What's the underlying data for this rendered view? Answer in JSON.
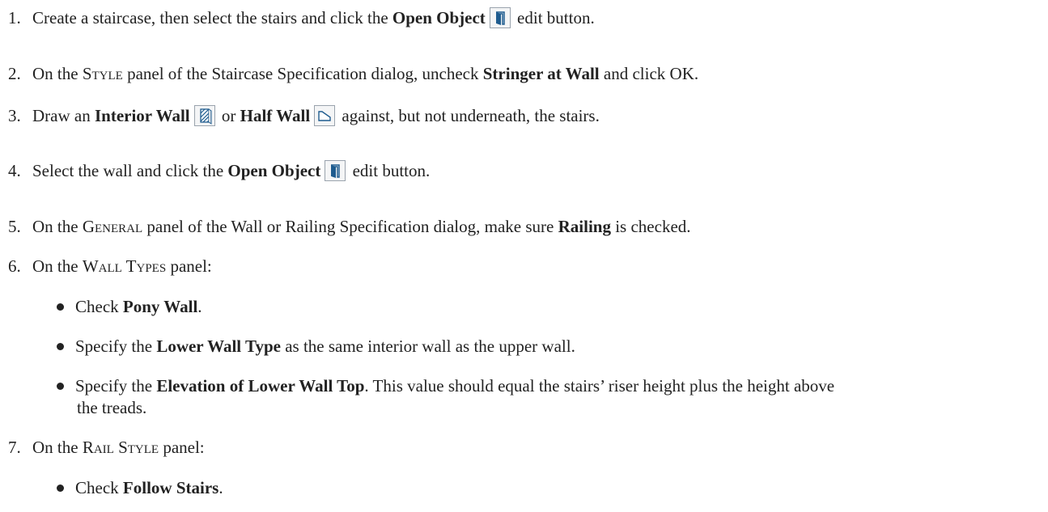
{
  "steps": [
    {
      "num": "1.",
      "a": "Create a staircase, then select the stairs and click the ",
      "b": "Open Object",
      "c": " edit button."
    },
    {
      "num": "2.",
      "a": "On the ",
      "sc": "Style",
      "b_pre": " panel of the Staircase Specification dialog, uncheck ",
      "b": "Stringer at Wall",
      "c": " and click OK."
    },
    {
      "num": "3.",
      "a": "Draw an ",
      "b1": "Interior Wall",
      "mid": " or ",
      "b2": "Half Wall",
      "c": " against, but not underneath, the stairs."
    },
    {
      "num": "4.",
      "a": "Select the wall and click the ",
      "b": "Open Object",
      "c": " edit button."
    },
    {
      "num": "5.",
      "a": "On the ",
      "sc": "General",
      "b_pre": " panel of the Wall or Railing Specification dialog, make sure ",
      "b": "Railing",
      "c": " is checked."
    },
    {
      "num": "6.",
      "a": "On the ",
      "sc": "Wall Types",
      "c": " panel:"
    },
    {
      "num": "7.",
      "a": "On the ",
      "sc": "Rail Style",
      "c": " panel:"
    }
  ],
  "bullets6": [
    {
      "a": "Check ",
      "b": "Pony Wall",
      "c": "."
    },
    {
      "a": "Specify the ",
      "b": "Lower Wall Type",
      "c": " as the same interior wall as the upper wall."
    },
    {
      "a": "Specify the ",
      "b": "Elevation of Lower Wall Top",
      "c": ". This value should equal the stairs’ riser height plus the height above",
      "cont": "the treads."
    }
  ],
  "bullets7": [
    {
      "a": "Check ",
      "b": "Follow Stairs",
      "c": "."
    }
  ],
  "icons": {
    "open_object": "open-object-icon",
    "interior_wall": "interior-wall-icon",
    "half_wall": "half-wall-icon"
  },
  "colors": {
    "text": "#222222",
    "icon_blue": "#1f5c8f",
    "icon_border": "#9aa3ad"
  }
}
